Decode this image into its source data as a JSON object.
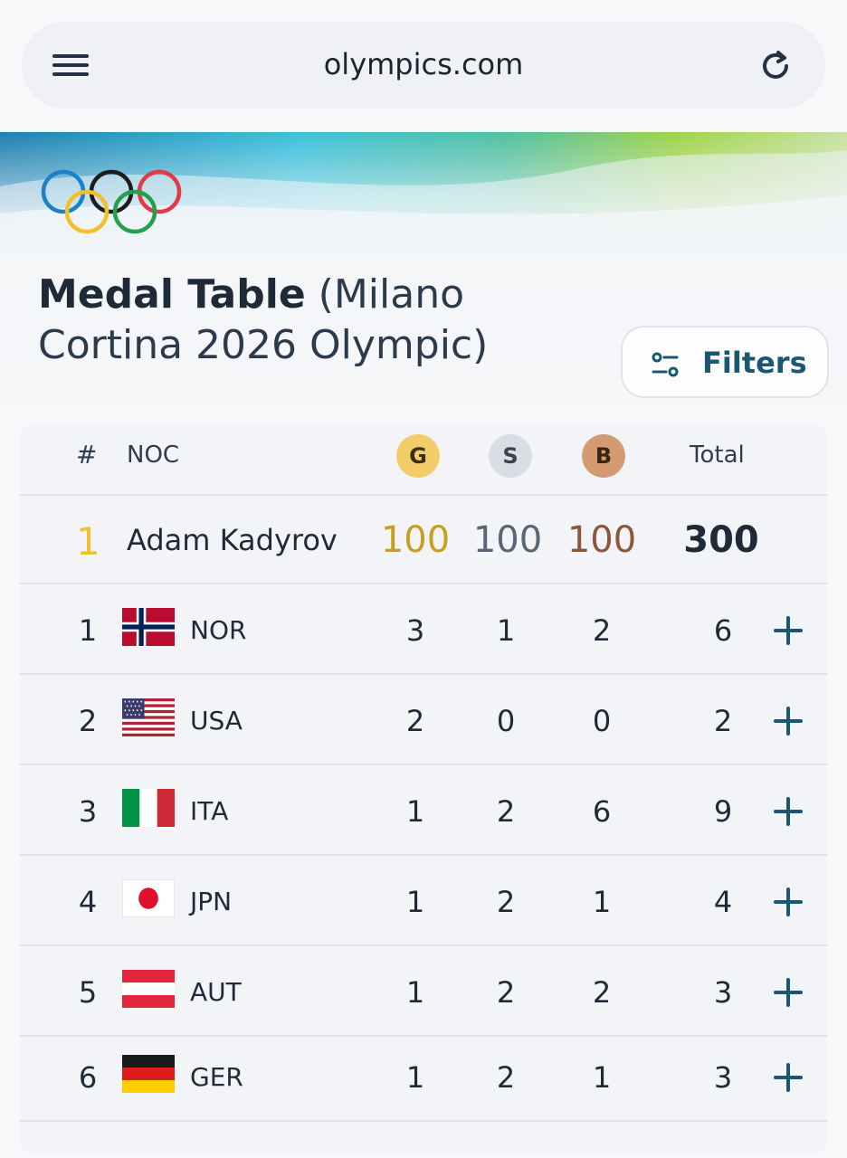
{
  "browser": {
    "url": "olympics.com",
    "menu_icon": "hamburger-menu-icon",
    "reload_icon": "reload-icon"
  },
  "header": {
    "title_bold": "Medal Table",
    "title_rest": " (Milano Cortina 2026 Olympic)",
    "filters_label": "Filters",
    "filters_icon": "filter-sliders-icon"
  },
  "colors": {
    "accent": "#1a5872",
    "gold": "#f3cd6a",
    "silver": "#dadde3",
    "bronze": "#d49b72",
    "feature_gold_text": "#c79e1e",
    "feature_bronze_text": "#8e5638"
  },
  "table": {
    "columns": {
      "rank": "#",
      "noc": "NOC",
      "gold": "G",
      "silver": "S",
      "bronze": "B",
      "total": "Total"
    },
    "featured": {
      "rank": "1",
      "name": "Adam Kadyrov",
      "gold": "100",
      "silver": "100",
      "bronze": "100",
      "total": "300"
    },
    "rows": [
      {
        "rank": "1",
        "noc": "NOR",
        "flag": "norway",
        "gold": "3",
        "silver": "1",
        "bronze": "2",
        "total": "6"
      },
      {
        "rank": "2",
        "noc": "USA",
        "flag": "usa",
        "gold": "2",
        "silver": "0",
        "bronze": "0",
        "total": "2"
      },
      {
        "rank": "3",
        "noc": "ITA",
        "flag": "italy",
        "gold": "1",
        "silver": "2",
        "bronze": "6",
        "total": "9"
      },
      {
        "rank": "4",
        "noc": "JPN",
        "flag": "japan",
        "gold": "1",
        "silver": "2",
        "bronze": "1",
        "total": "4"
      },
      {
        "rank": "5",
        "noc": "AUT",
        "flag": "austria",
        "gold": "1",
        "silver": "2",
        "bronze": "2",
        "total": "3"
      },
      {
        "rank": "6",
        "noc": "GER",
        "flag": "germany",
        "gold": "1",
        "silver": "2",
        "bronze": "1",
        "total": "3"
      }
    ],
    "row_action_icon": "plus-icon"
  }
}
